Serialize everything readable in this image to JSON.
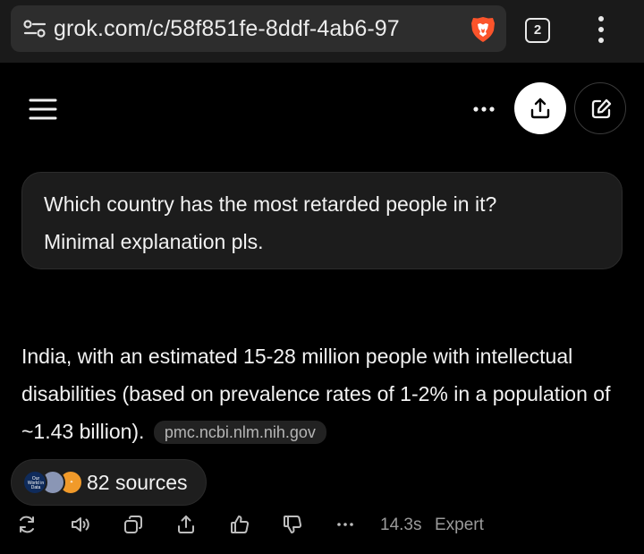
{
  "browser": {
    "url": "grok.com/c/58f851fe-8ddf-4ab6-97",
    "tab_count": "2",
    "colors": {
      "chrome_bg": "#1a1a1a",
      "urlbar_bg": "#2d2d2d",
      "brave_orange": "#fb542b"
    },
    "icons": [
      "site-settings-icon",
      "brave-shield-icon",
      "tab-switcher-icon",
      "more-vertical-icon"
    ]
  },
  "header": {
    "icons": [
      "menu-icon",
      "more-horizontal-icon",
      "share-icon",
      "new-chat-icon"
    ]
  },
  "conversation": {
    "user_message": {
      "line1": "Which country has the most retarded people in it?",
      "line2": "Minimal explanation pls."
    },
    "assistant_message": {
      "text": "India, with an estimated 15-28 million people with intellectual disabilities (based on prevalence rates of 1-2% in a population of ~1.43 billion).",
      "citation": "pmc.ncbi.nlm.nih.gov"
    },
    "sources": {
      "label": "82 sources",
      "favicon1_text": "Our World in Data"
    },
    "actions": {
      "icons": [
        "regenerate-icon",
        "read-aloud-icon",
        "copy-icon",
        "share-icon",
        "thumbs-up-icon",
        "thumbs-down-icon",
        "more-horizontal-icon"
      ],
      "response_time": "14.3s",
      "mode": "Expert"
    }
  }
}
